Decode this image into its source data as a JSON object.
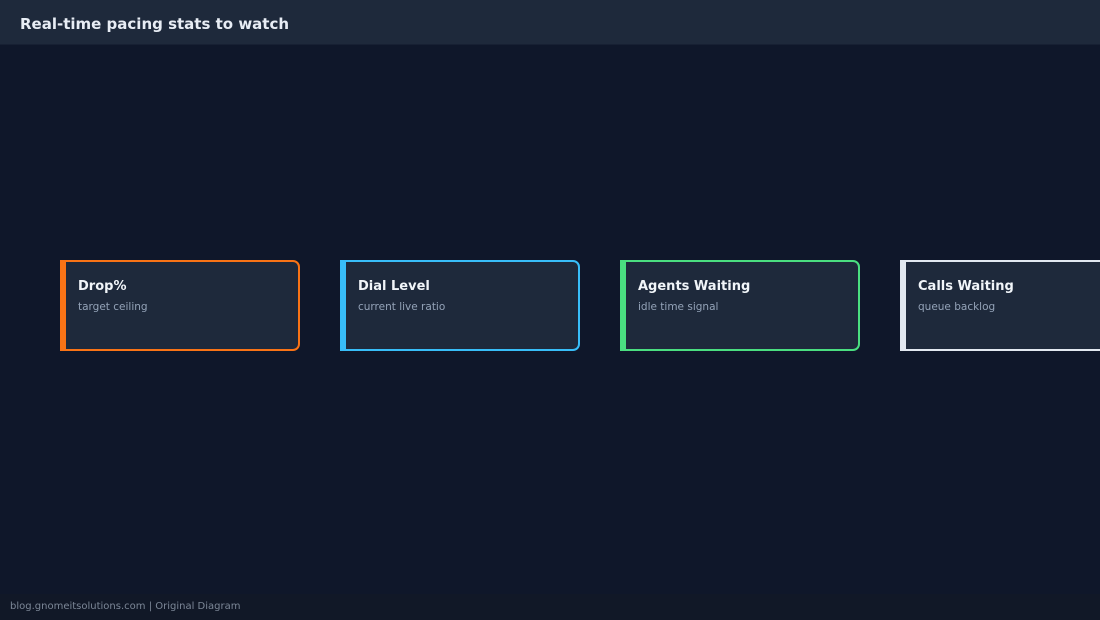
{
  "header": {
    "title": "Real-time pacing stats to watch"
  },
  "cards": [
    {
      "title": "Drop%",
      "subtitle": "target ceiling",
      "color": "#f97316"
    },
    {
      "title": "Dial Level",
      "subtitle": "current live ratio",
      "color": "#38bdf8"
    },
    {
      "title": "Agents Waiting",
      "subtitle": "idle time signal",
      "color": "#4ade80"
    },
    {
      "title": "Calls Waiting",
      "subtitle": "queue backlog",
      "color": "#e2e8f0"
    }
  ],
  "footer": {
    "text": "blog.gnomeitsolutions.com | Original Diagram"
  }
}
